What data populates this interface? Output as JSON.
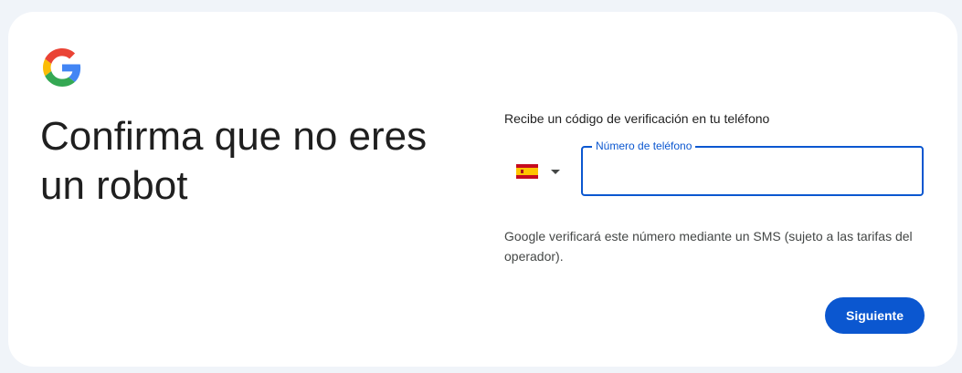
{
  "brand": {
    "logo_icon": "google-g-icon",
    "colors": {
      "blue": "#4285F4",
      "red": "#EA4335",
      "yellow": "#FBBC05",
      "green": "#34A853"
    }
  },
  "page": {
    "title": "Confirma que no eres un robot"
  },
  "form": {
    "subtitle": "Recibe un código de verificación en tu teléfono",
    "country_selector": {
      "flag_icon": "spain-flag-icon",
      "dropdown_icon": "caret-down-icon"
    },
    "phone_field": {
      "label": "Número de teléfono",
      "value": ""
    },
    "note": "Google verificará este número mediante un SMS (sujeto a las tarifas del operador).",
    "next_label": "Siguiente"
  },
  "colors": {
    "accent": "#0b57d0",
    "background": "#f0f4f9",
    "card": "#ffffff",
    "text": "#1f1f1f"
  }
}
